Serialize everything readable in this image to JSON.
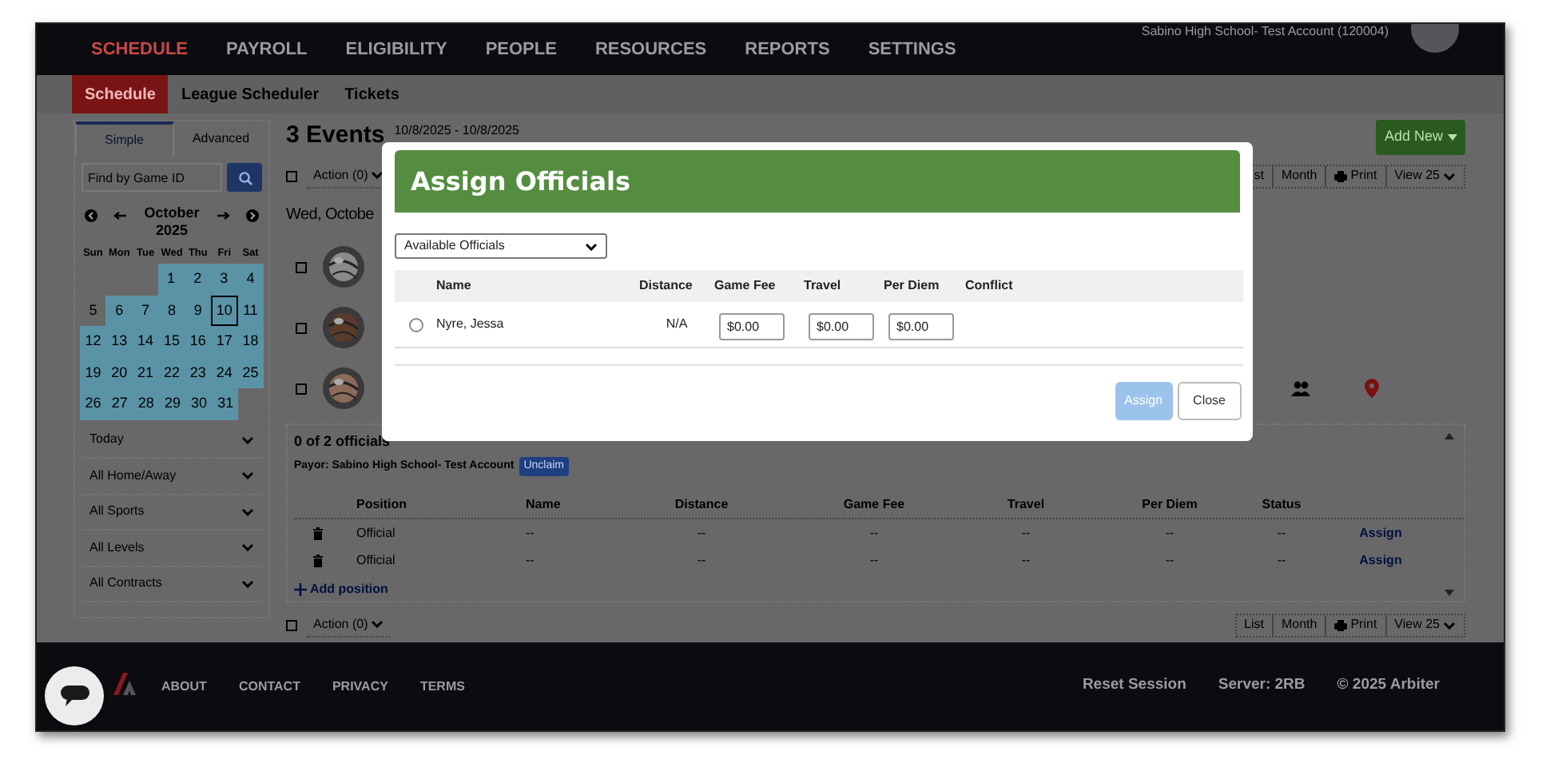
{
  "account": "Sabino High School- Test Account (120004)",
  "nav": [
    {
      "label": "SCHEDULE",
      "selected": true
    },
    {
      "label": "PAYROLL",
      "selected": false
    },
    {
      "label": "ELIGIBILITY",
      "selected": false
    },
    {
      "label": "PEOPLE",
      "selected": false
    },
    {
      "label": "RESOURCES",
      "selected": false
    },
    {
      "label": "REPORTS",
      "selected": false
    },
    {
      "label": "SETTINGS",
      "selected": false
    }
  ],
  "subnav": [
    {
      "label": "Schedule",
      "selected": true
    },
    {
      "label": "League Scheduler",
      "selected": false
    },
    {
      "label": "Tickets",
      "selected": false
    }
  ],
  "sidebar": {
    "tabs": [
      {
        "label": "Simple",
        "selected": true
      },
      {
        "label": "Advanced",
        "selected": false
      }
    ],
    "search": {
      "placeholder": "Find by Game ID"
    },
    "calendar": {
      "month": "October",
      "year": "2025",
      "weekdays": [
        "Sun",
        "Mon",
        "Tue",
        "Wed",
        "Thu",
        "Fri",
        "Sat"
      ],
      "weeks": [
        [
          {
            "label": "1",
            "highlighted": true,
            "selected": false
          },
          {
            "label": "2",
            "highlighted": true,
            "selected": false
          },
          {
            "label": "3",
            "highlighted": true,
            "selected": false
          },
          {
            "label": "4",
            "highlighted": true,
            "selected": false
          }
        ],
        [
          {
            "label": "5",
            "highlighted": false,
            "selected": false
          },
          {
            "label": "6",
            "highlighted": true,
            "selected": false
          },
          {
            "label": "7",
            "highlighted": true,
            "selected": false
          },
          {
            "label": "8",
            "highlighted": true,
            "selected": false
          },
          {
            "label": "9",
            "highlighted": true,
            "selected": false
          },
          {
            "label": "10",
            "highlighted": true,
            "selected": true
          },
          {
            "label": "11",
            "highlighted": true,
            "selected": false
          }
        ],
        [
          {
            "label": "12",
            "highlighted": true,
            "selected": false
          },
          {
            "label": "13",
            "highlighted": true,
            "selected": false
          },
          {
            "label": "14",
            "highlighted": true,
            "selected": false
          },
          {
            "label": "15",
            "highlighted": true,
            "selected": false
          },
          {
            "label": "16",
            "highlighted": true,
            "selected": false
          },
          {
            "label": "17",
            "highlighted": true,
            "selected": false
          },
          {
            "label": "18",
            "highlighted": true,
            "selected": false
          }
        ],
        [
          {
            "label": "19",
            "highlighted": true,
            "selected": false
          },
          {
            "label": "20",
            "highlighted": true,
            "selected": false
          },
          {
            "label": "21",
            "highlighted": true,
            "selected": false
          },
          {
            "label": "22",
            "highlighted": true,
            "selected": false
          },
          {
            "label": "23",
            "highlighted": true,
            "selected": false
          },
          {
            "label": "24",
            "highlighted": true,
            "selected": false
          },
          {
            "label": "25",
            "highlighted": true,
            "selected": false
          }
        ],
        [
          {
            "label": "26",
            "highlighted": true,
            "selected": false
          },
          {
            "label": "27",
            "highlighted": true,
            "selected": false
          },
          {
            "label": "28",
            "highlighted": true,
            "selected": false
          },
          {
            "label": "29",
            "highlighted": true,
            "selected": false
          },
          {
            "label": "30",
            "highlighted": true,
            "selected": false
          },
          {
            "label": "31",
            "highlighted": true,
            "selected": false
          }
        ]
      ]
    },
    "filters": [
      {
        "label": "Today"
      },
      {
        "label": "All Home/Away"
      },
      {
        "label": "All Sports"
      },
      {
        "label": "All Levels"
      },
      {
        "label": "All Contracts"
      }
    ]
  },
  "main": {
    "title": "3 Events",
    "range": "10/8/2025 - 10/8/2025",
    "add_new": "Add New",
    "action": "Action (0)",
    "checked": false,
    "views": [
      "st",
      "Month",
      "Print",
      "View 25"
    ],
    "day_heading": "Wed, Octobe",
    "events": [
      {
        "checked": false,
        "kind": "plain"
      },
      {
        "checked": false,
        "kind": "plain"
      },
      {
        "checked": false,
        "kind": "icons"
      }
    ],
    "panel": {
      "count": "0 of 2 officials",
      "payor": "Payor: Sabino High School- Test Account",
      "badge": "Unclaim",
      "columns": [
        "Position",
        "Name",
        "Distance",
        "Game Fee",
        "Travel",
        "Per Diem",
        "Status"
      ],
      "rows": [
        {
          "cells": [
            "Official",
            "--",
            "--",
            "--",
            "--",
            "--",
            "--"
          ],
          "action": "Assign"
        },
        {
          "cells": [
            "Official",
            "--",
            "--",
            "--",
            "--",
            "--",
            "--"
          ],
          "action": "Assign"
        }
      ],
      "add": "Add position"
    },
    "bottom": {
      "action": "Action (0)",
      "checked": false,
      "views": [
        "List",
        "Month",
        "Print",
        "View 25"
      ]
    }
  },
  "footer": {
    "links": [
      "ABOUT",
      "CONTACT",
      "PRIVACY",
      "TERMS"
    ],
    "right": [
      "Reset Session",
      "Server: 2RB",
      "© 2025 Arbiter"
    ]
  },
  "modal": {
    "title": "Assign Officials",
    "select": "Available Officials",
    "columns": [
      "Name",
      "Distance",
      "Game Fee",
      "Travel",
      "Per Diem",
      "Conflict"
    ],
    "rows": [
      {
        "selected": false,
        "name": "Nyre, Jessa",
        "distance": "N/A",
        "game_fee": "$0.00",
        "travel": "$0.00",
        "per_diem": "$0.00"
      }
    ],
    "buttons": [
      {
        "label": "Assign",
        "disabled": true
      },
      {
        "label": "Close",
        "disabled": false
      }
    ]
  }
}
